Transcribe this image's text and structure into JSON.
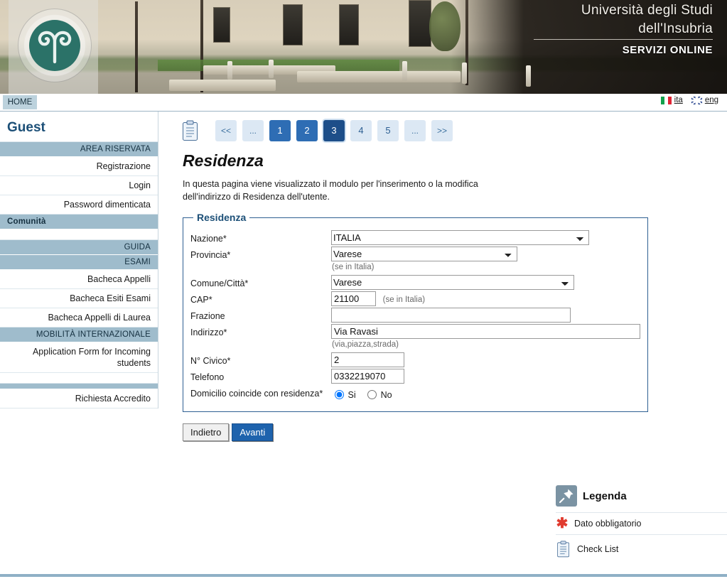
{
  "banner": {
    "title_line1": "Università degli Studi",
    "title_line2": "dell'Insubria",
    "subtitle": "SERVIZI ONLINE",
    "seal_alt": "university-seal"
  },
  "navbar": {
    "home_label": "HOME",
    "lang_ita": "ita",
    "lang_eng": "eng"
  },
  "sidebar": {
    "user": "Guest",
    "groups": [
      {
        "header": "AREA RISERVATA",
        "align": "right",
        "items": [
          "Registrazione",
          "Login",
          "Password dimenticata"
        ]
      },
      {
        "header": "Comunità",
        "align": "left",
        "items": []
      },
      {
        "header": "GUIDA",
        "align": "right",
        "items": []
      },
      {
        "header": "ESAMI",
        "align": "right",
        "items": [
          "Bacheca Appelli",
          "Bacheca Esiti Esami",
          "Bacheca Appelli di Laurea"
        ]
      },
      {
        "header": "MOBILITÀ INTERNAZIONALE",
        "align": "right",
        "items": [
          "Application Form for Incoming students"
        ]
      },
      {
        "header": "",
        "align": "right",
        "items": [
          "Richiesta Accredito"
        ]
      }
    ]
  },
  "steps": {
    "icon": "checklist-icon",
    "prev_label": "<<",
    "ellipsis_left": "...",
    "items": [
      {
        "label": "1",
        "state": "done"
      },
      {
        "label": "2",
        "state": "done"
      },
      {
        "label": "3",
        "state": "current"
      },
      {
        "label": "4",
        "state": "idle"
      },
      {
        "label": "5",
        "state": "idle"
      }
    ],
    "ellipsis_right": "...",
    "next_label": ">>"
  },
  "main": {
    "title": "Residenza",
    "description": "In questa pagina viene visualizzato il modulo per l'inserimento o la modifica dell'indirizzo di Residenza dell'utente.",
    "fieldset_legend": "Residenza"
  },
  "form": {
    "nazione": {
      "label": "Nazione*",
      "value": "ITALIA",
      "options": [
        "ITALIA"
      ]
    },
    "provincia": {
      "label": "Provincia*",
      "value": "Varese",
      "options": [
        "Varese"
      ],
      "hint": "(se in Italia)"
    },
    "comune": {
      "label": "Comune/Città*",
      "value": "Varese",
      "options": [
        "Varese"
      ]
    },
    "cap": {
      "label": "CAP*",
      "value": "21100",
      "hint": "(se in Italia)"
    },
    "frazione": {
      "label": "Frazione",
      "value": ""
    },
    "indirizzo": {
      "label": "Indirizzo*",
      "value": "Via Ravasi",
      "hint": "(via,piazza,strada)"
    },
    "civico": {
      "label": "N° Civico*",
      "value": "2"
    },
    "telefono": {
      "label": "Telefono",
      "value": "0332219070"
    },
    "domicilio": {
      "label": "Domicilio coincide con residenza*",
      "yes_label": "Si",
      "no_label": "No",
      "selected": "Si"
    }
  },
  "buttons": {
    "back": "Indietro",
    "next": "Avanti"
  },
  "legend_panel": {
    "title": "Legenda",
    "pin_icon": "pushpin-icon",
    "rows": [
      {
        "icon": "asterisk-icon",
        "label": "Dato obbligatorio"
      },
      {
        "icon": "checklist-icon",
        "label": "Check List"
      }
    ]
  },
  "colors": {
    "accent_blue": "#1d4e89",
    "step_done": "#2e6db4",
    "step_idle": "#dce8f4",
    "sidebar_header": "#9fbccc",
    "seal_teal": "#2b7268",
    "required_red": "#e03b2f"
  }
}
